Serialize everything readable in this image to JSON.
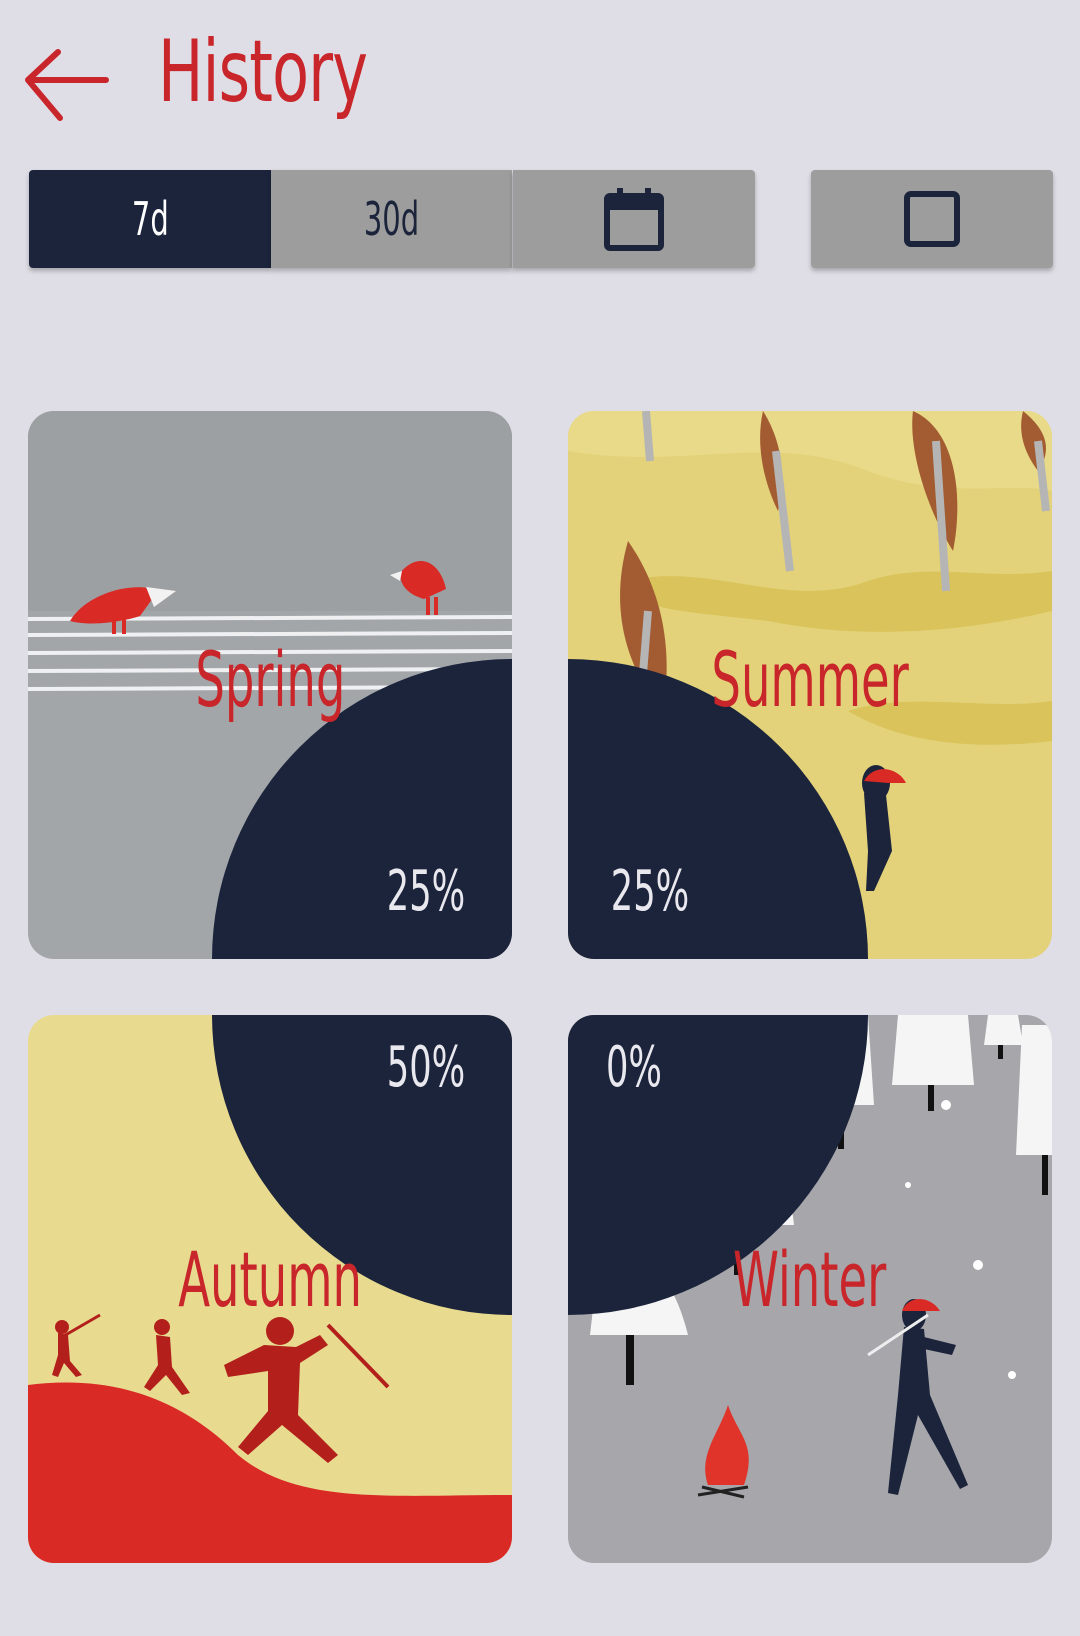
{
  "header": {
    "title": "History",
    "back_icon": "arrow-left-icon"
  },
  "range_selector": {
    "options": [
      {
        "label": "7d",
        "selected": true
      },
      {
        "label": "30d",
        "selected": false
      },
      {
        "icon": "calendar-icon",
        "selected": false
      }
    ],
    "extra_icon": "square-icon"
  },
  "seasons": [
    {
      "name": "Spring",
      "percent_label": "25%",
      "percent": 25
    },
    {
      "name": "Summer",
      "percent_label": "25%",
      "percent": 25
    },
    {
      "name": "Autumn",
      "percent_label": "50%",
      "percent": 50
    },
    {
      "name": "Winter",
      "percent_label": "0%",
      "percent": 0
    }
  ],
  "colors": {
    "accent_red": "#c8262a",
    "navy": "#1b243b",
    "background": "#dfdee6",
    "inactive_segment": "#9d9d9d"
  }
}
